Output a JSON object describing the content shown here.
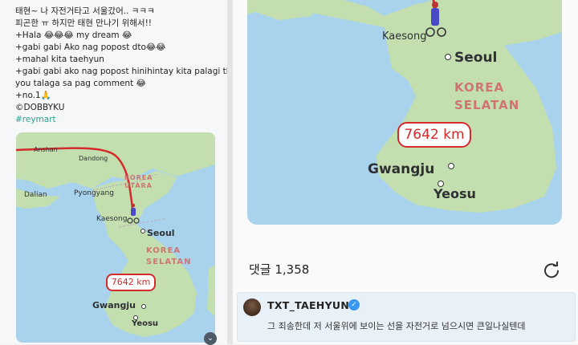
{
  "post": {
    "lines": [
      "태현~ 나 자전거타고 서울갔어.. ㅋㅋㅋ",
      "피곤한 ㅠ 하지만 태현 만나기 위해서!!",
      "+Hala 😂😂😂 my dream 😂",
      "+gabi gabi Ako nag popost dto😂😂",
      "+mahal kita taehyun",
      "+gabi gabi ako nag popost hinihintay kita palagi thank",
      "you talaga sa pag comment 😂",
      "+no.1🙏",
      "©DOBBYKU"
    ],
    "hashtag": "#reymart"
  },
  "map_left": {
    "labels": {
      "korea_utara_1": "KOREA",
      "korea_utara_2": "UTARA",
      "korea_selatan_1": "KOREA",
      "korea_selatan_2": "SELATAN",
      "dalian": "Dalian",
      "pyongyang": "Pyongyang",
      "kaesong": "Kaesong",
      "seoul": "Seoul",
      "gwangju": "Gwangju",
      "yeosu": "Yeosu",
      "dandong": "Dandong",
      "anshan": "Anshan"
    },
    "distance": "7642 km"
  },
  "map_right": {
    "labels": {
      "kaesong": "Kaesong",
      "seoul": "Seoul",
      "korea_selatan_1": "KOREA",
      "korea_selatan_2": "SELATAN",
      "gwangju": "Gwangju",
      "yeosu": "Yeosu"
    },
    "distance": "7642 km"
  },
  "comments": {
    "count_label": "댓글 1,358"
  },
  "comment": {
    "username": "TXT_TAEHYUN",
    "text": "그 죄송한데 저 서울위에 보이는 선을 자전거로 넘으시면 큰일나실텐데"
  },
  "colors": {
    "sea": "#a9d3ec",
    "land": "#c3dfb0",
    "route": "#d42a2a",
    "hashtag": "#2aa38f",
    "verified": "#3897f0"
  },
  "icons": [
    "refresh-icon",
    "verified-badge-icon",
    "chevron-down-icon",
    "bicycle-rider-icon"
  ]
}
